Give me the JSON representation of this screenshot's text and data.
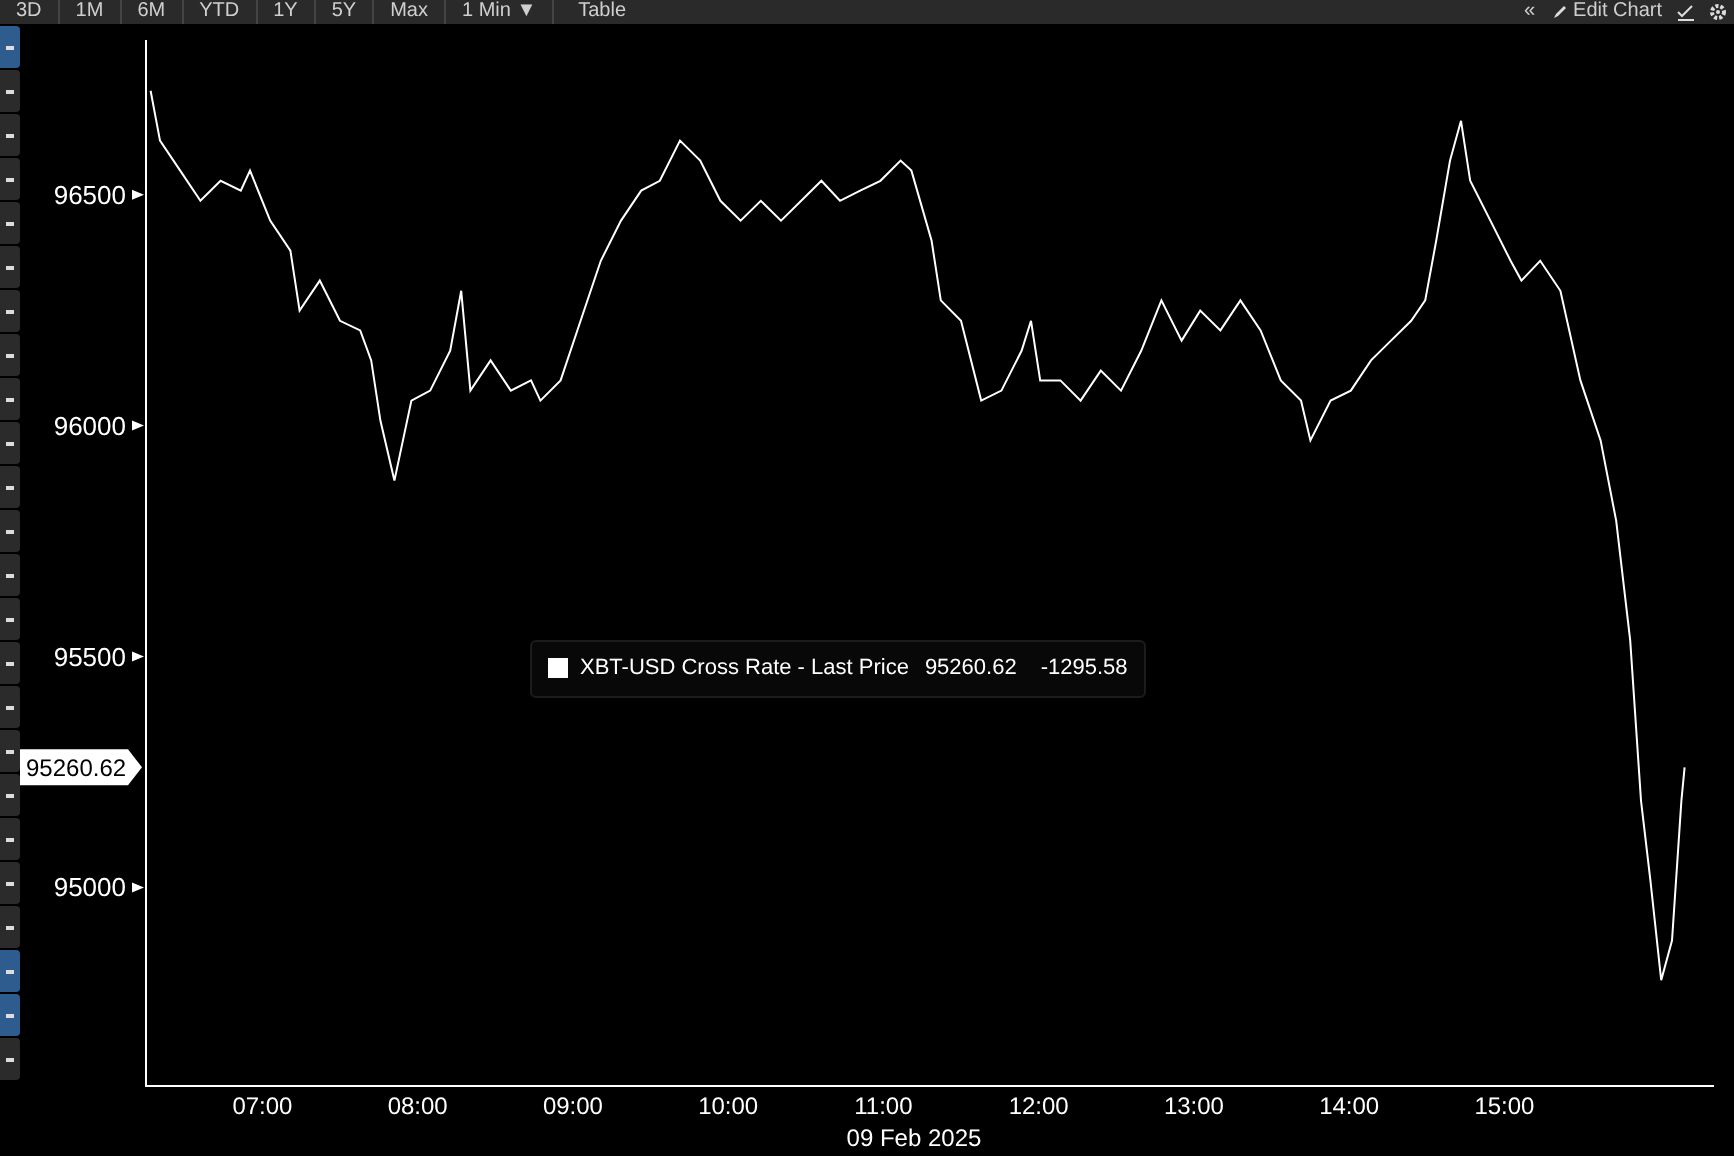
{
  "toolbar": {
    "ranges": [
      {
        "label": "3D",
        "selected": false
      },
      {
        "label": "1M",
        "selected": false
      },
      {
        "label": "6M",
        "selected": false
      },
      {
        "label": "YTD",
        "selected": false
      },
      {
        "label": "1Y",
        "selected": false
      },
      {
        "label": "5Y",
        "selected": false
      },
      {
        "label": "Max",
        "selected": false
      }
    ],
    "interval": "1 Min ▼",
    "table_button": "Table",
    "collapse_icon": "«",
    "edit_chart": "Edit Chart"
  },
  "side_tools": [
    {
      "selected": true
    },
    {
      "selected": false
    },
    {
      "selected": false
    },
    {
      "selected": false
    },
    {
      "selected": false
    },
    {
      "selected": false
    },
    {
      "selected": false
    },
    {
      "selected": false
    },
    {
      "selected": false
    },
    {
      "selected": false
    },
    {
      "selected": false
    },
    {
      "selected": false
    },
    {
      "selected": false
    },
    {
      "selected": false
    },
    {
      "selected": false
    },
    {
      "selected": false
    },
    {
      "selected": false
    },
    {
      "selected": false
    },
    {
      "selected": false
    },
    {
      "selected": false
    },
    {
      "selected": false
    },
    {
      "selected": true
    },
    {
      "selected": true
    },
    {
      "selected": false
    }
  ],
  "chart": {
    "price_tag": "95260.62",
    "legend": {
      "last": "95260.62",
      "change": "-1295.58"
    },
    "chart_data": {
      "type": "line",
      "xlabel": "09 Feb 2025",
      "xlim": [
        6.25,
        16.35
      ],
      "ylim": [
        94570,
        96835
      ],
      "xticks": [
        {
          "value": 7,
          "label": "07:00"
        },
        {
          "value": 8,
          "label": "08:00"
        },
        {
          "value": 9,
          "label": "09:00"
        },
        {
          "value": 10,
          "label": "10:00"
        },
        {
          "value": 11,
          "label": "11:00"
        },
        {
          "value": 12,
          "label": "12:00"
        },
        {
          "value": 13,
          "label": "13:00"
        },
        {
          "value": 14,
          "label": "14:00"
        },
        {
          "value": 15,
          "label": "15:00"
        }
      ],
      "yticks": [
        95000,
        95500,
        96000,
        96500
      ],
      "x": [
        6.28,
        6.34,
        6.47,
        6.6,
        6.73,
        6.86,
        6.92,
        7.05,
        7.18,
        7.24,
        7.37,
        7.5,
        7.63,
        7.7,
        7.76,
        7.85,
        7.96,
        8.08,
        8.21,
        8.28,
        8.34,
        8.47,
        8.6,
        8.73,
        8.79,
        8.92,
        9.05,
        9.18,
        9.31,
        9.44,
        9.56,
        9.69,
        9.82,
        9.95,
        10.08,
        10.21,
        10.34,
        10.47,
        10.6,
        10.72,
        10.85,
        10.98,
        11.11,
        11.18,
        11.31,
        11.37,
        11.5,
        11.63,
        11.76,
        11.89,
        11.95,
        12.01,
        12.14,
        12.27,
        12.4,
        12.53,
        12.66,
        12.79,
        12.92,
        13.04,
        13.17,
        13.3,
        13.43,
        13.56,
        13.69,
        13.75,
        13.88,
        14.01,
        14.14,
        14.27,
        14.4,
        14.49,
        14.56,
        14.65,
        14.72,
        14.78,
        14.91,
        15.04,
        15.11,
        15.23,
        15.36,
        15.49,
        15.62,
        15.72,
        15.81,
        15.88,
        15.94,
        16.01,
        16.08,
        16.14,
        16.16
      ],
      "series": [
        {
          "name": "XBT-USD Cross Rate - Last Price",
          "color": "#ffffff",
          "values": [
            96725,
            96617,
            96552,
            96487,
            96530,
            96509,
            96552,
            96444,
            96379,
            96249,
            96314,
            96227,
            96206,
            96141,
            96011,
            95881,
            96054,
            96076,
            96162,
            96292,
            96076,
            96141,
            96076,
            96098,
            96054,
            96098,
            96227,
            96357,
            96444,
            96509,
            96530,
            96617,
            96574,
            96487,
            96444,
            96487,
            96444,
            96487,
            96530,
            96487,
            96509,
            96530,
            96574,
            96552,
            96400,
            96271,
            96227,
            96054,
            96076,
            96162,
            96227,
            96098,
            96098,
            96054,
            96119,
            96076,
            96162,
            96271,
            96184,
            96249,
            96206,
            96271,
            96206,
            96098,
            96054,
            95968,
            96054,
            96076,
            96141,
            96184,
            96227,
            96271,
            96400,
            96574,
            96660,
            96530,
            96444,
            96357,
            96314,
            96357,
            96292,
            96098,
            95968,
            95794,
            95535,
            95188,
            95015,
            94799,
            94885,
            95188,
            95260
          ]
        }
      ]
    }
  }
}
